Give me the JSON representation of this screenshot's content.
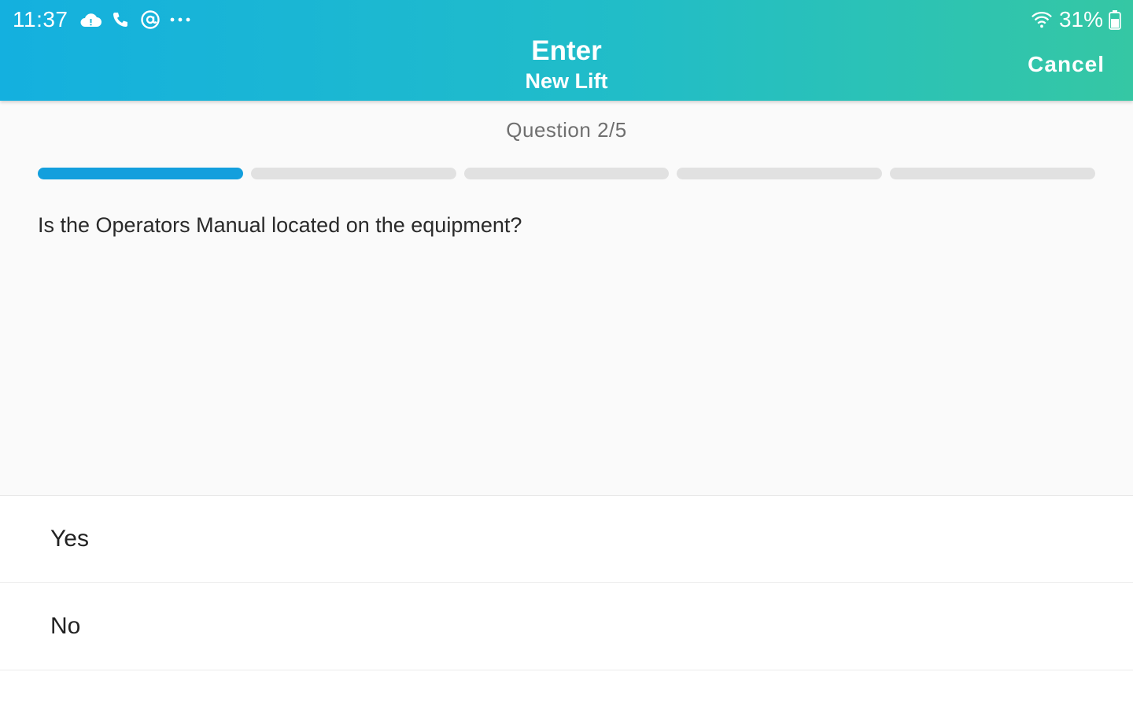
{
  "status_bar": {
    "time": "11:37",
    "icons": [
      "cloud-alert-icon",
      "phone-icon",
      "at-sign-icon",
      "more-dots-icon"
    ],
    "wifi_icon": "wifi-icon",
    "battery_percent": "31%",
    "battery_icon": "battery-icon"
  },
  "header": {
    "title": "Enter",
    "subtitle": "New Lift",
    "cancel_label": "Cancel",
    "gradient_start": "#14b0df",
    "gradient_end": "#35c7a4"
  },
  "question": {
    "counter": "Question 2/5",
    "current": 2,
    "total": 5,
    "text": "Is the Operators Manual located on the equipment?",
    "progress_color": "#139fdd"
  },
  "answers": [
    {
      "label": "Yes"
    },
    {
      "label": "No"
    }
  ]
}
